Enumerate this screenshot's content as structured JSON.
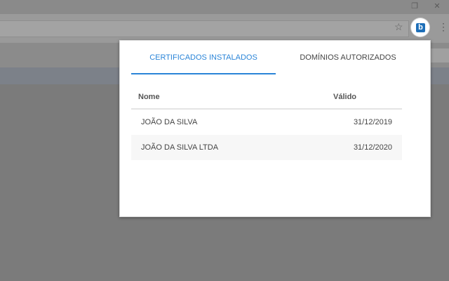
{
  "window": {
    "restore_glyph": "❐",
    "close_glyph": "✕"
  },
  "toolbar": {
    "star_glyph": "☆",
    "extension_icon_letter": "b",
    "menu_glyph": "⋮"
  },
  "popup": {
    "tabs": [
      {
        "label": "CERTIFICADOS INSTALADOS",
        "active": true
      },
      {
        "label": "DOMÍNIOS AUTORIZADOS",
        "active": false
      }
    ],
    "table": {
      "headers": {
        "name": "Nome",
        "valid": "Válido"
      },
      "rows": [
        {
          "name": "JOÃO DA SILVA",
          "valid": "31/12/2019"
        },
        {
          "name": "JOÃO DA SILVA LTDA",
          "valid": "31/12/2020"
        }
      ]
    }
  },
  "colors": {
    "accent": "#2b85d8",
    "extension_icon": "#1e6fb8"
  }
}
